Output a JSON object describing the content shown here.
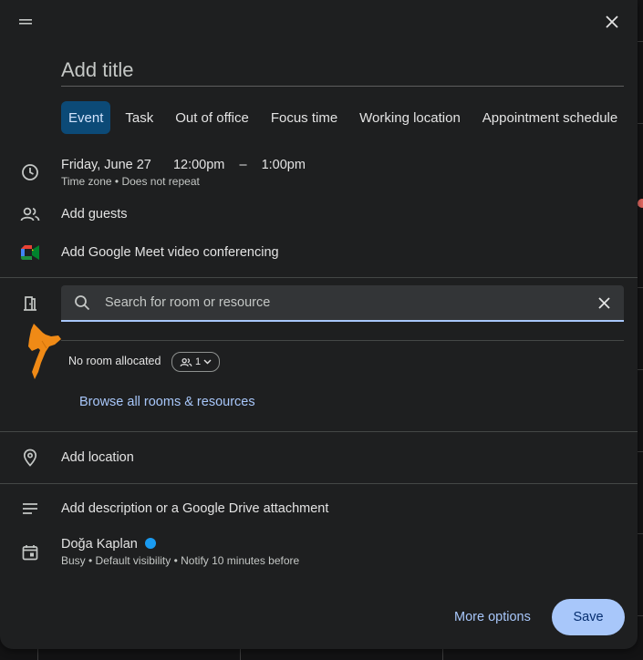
{
  "dialog": {
    "title_placeholder": "Add title",
    "tabs": [
      {
        "label": "Event",
        "active": true
      },
      {
        "label": "Task"
      },
      {
        "label": "Out of office"
      },
      {
        "label": "Focus time"
      },
      {
        "label": "Working location"
      },
      {
        "label": "Appointment schedule"
      }
    ],
    "datetime": {
      "date": "Friday, June 27",
      "start": "12:00pm",
      "separator": "–",
      "end": "1:00pm",
      "subtext": "Time zone • Does not repeat"
    },
    "add_guests": "Add guests",
    "meet": "Add Google Meet video conferencing",
    "rooms": {
      "search_placeholder": "Search for room or resource",
      "no_room": "No room allocated",
      "capacity": "1",
      "browse_link": "Browse all rooms & resources"
    },
    "location": "Add location",
    "description": "Add description or a Google Drive attachment",
    "calendar": {
      "owner": "Doğa Kaplan",
      "owner_color": "#1a9bf1",
      "subtext": "Busy • Default visibility • Notify 10 minutes before"
    },
    "buttons": {
      "more_options": "More options",
      "save": "Save"
    }
  },
  "colors": {
    "accent": "#a8c7fa",
    "active_tab_bg": "#0c4a77",
    "annotation_arrow": "#f08a16"
  }
}
